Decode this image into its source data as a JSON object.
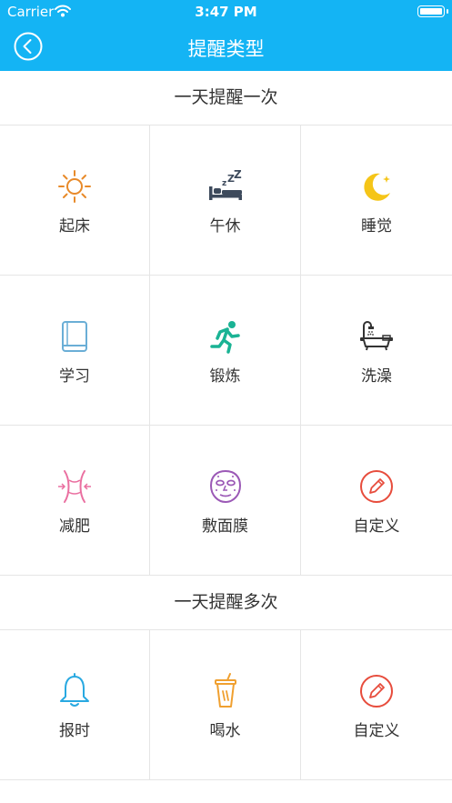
{
  "status": {
    "carrier": "Carrier",
    "time": "3:47 PM"
  },
  "nav": {
    "title": "提醒类型"
  },
  "sections": [
    {
      "title": "一天提醒一次",
      "items": [
        {
          "label": "起床",
          "icon": "sun-icon"
        },
        {
          "label": "午休",
          "icon": "sleep-bed-icon"
        },
        {
          "label": "睡觉",
          "icon": "moon-icon"
        },
        {
          "label": "学习",
          "icon": "book-icon"
        },
        {
          "label": "锻炼",
          "icon": "running-icon"
        },
        {
          "label": "洗澡",
          "icon": "bathtub-icon"
        },
        {
          "label": "减肥",
          "icon": "waist-icon"
        },
        {
          "label": "敷面膜",
          "icon": "face-mask-icon"
        },
        {
          "label": "自定义",
          "icon": "pencil-icon"
        }
      ]
    },
    {
      "title": "一天提醒多次",
      "items": [
        {
          "label": "报时",
          "icon": "bell-icon"
        },
        {
          "label": "喝水",
          "icon": "cup-icon"
        },
        {
          "label": "自定义",
          "icon": "pencil-icon"
        }
      ]
    }
  ],
  "colors": {
    "header": "#14b4f4",
    "sun": "#e88a2a",
    "bed": "#3d4a5c",
    "moon": "#f5c518",
    "book": "#6aaed6",
    "run": "#1ab394",
    "bath": "#333333",
    "waist": "#ea6fa0",
    "mask": "#9b59b6",
    "pencil": "#e74c3c",
    "bell": "#29a9e1",
    "cup": "#f0a030"
  }
}
